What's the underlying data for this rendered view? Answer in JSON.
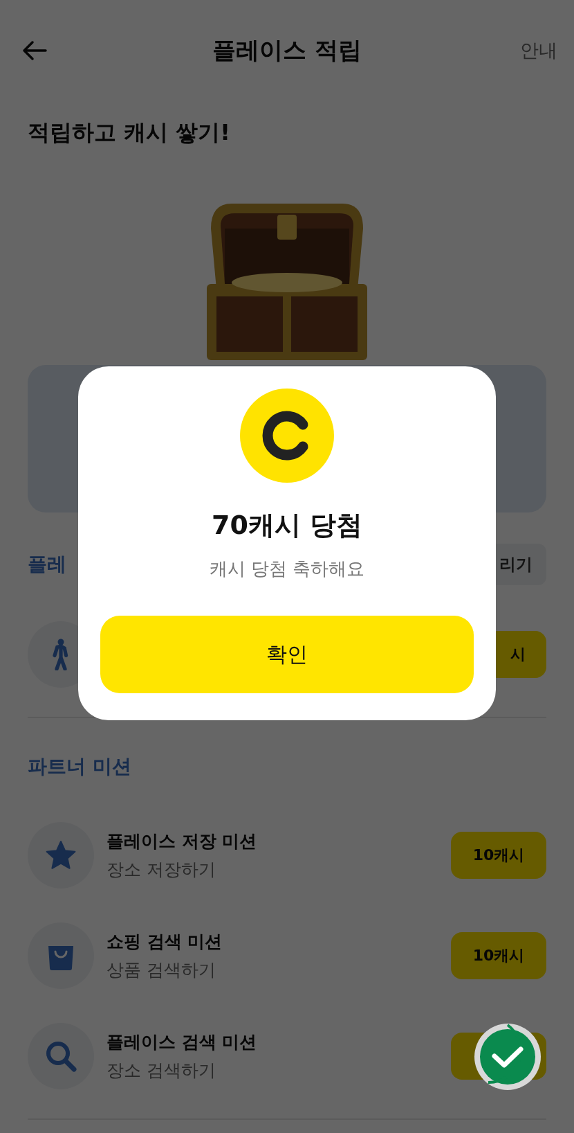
{
  "header": {
    "title": "플레이스 적립",
    "action": "안내"
  },
  "headline": "적립하고 캐시 쌓기!",
  "place_section": {
    "title": "플레",
    "action": "리기",
    "missions": [
      {
        "kind": "walk",
        "button": "시"
      }
    ]
  },
  "partner_section": {
    "title": "파트너 미션",
    "missions": [
      {
        "kind": "star",
        "title": "플레이스 저장 미션",
        "subtitle": "장소 저장하기",
        "button": "10캐시"
      },
      {
        "kind": "bag",
        "title": "쇼핑 검색 미션",
        "subtitle": "상품 검색하기",
        "button": "10캐시"
      },
      {
        "kind": "search",
        "title": "플레이스 검색 미션",
        "subtitle": "장소 검색하기"
      }
    ]
  },
  "dialog": {
    "title": "70캐시 당첨",
    "message": "캐시 당첨 축하해요",
    "confirm": "확인"
  }
}
